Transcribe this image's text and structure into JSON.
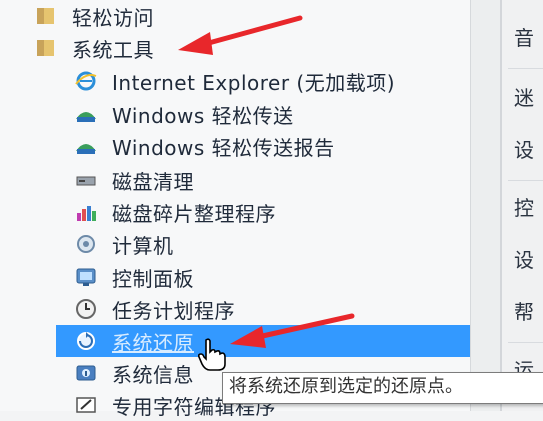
{
  "menu": {
    "items": [
      {
        "label": "轻松访问",
        "icon": "folder-icon"
      },
      {
        "label": "系统工具",
        "icon": "folder-icon"
      },
      {
        "label": "Internet Explorer (无加载项)",
        "icon": "internet-explorer-icon"
      },
      {
        "label": "Windows 轻松传送",
        "icon": "easy-transfer-icon"
      },
      {
        "label": "Windows 轻松传送报告",
        "icon": "easy-transfer-report-icon"
      },
      {
        "label": "磁盘清理",
        "icon": "disk-cleanup-icon"
      },
      {
        "label": "磁盘碎片整理程序",
        "icon": "defragmenter-icon"
      },
      {
        "label": "计算机",
        "icon": "computer-icon"
      },
      {
        "label": "控制面板",
        "icon": "control-panel-icon"
      },
      {
        "label": "任务计划程序",
        "icon": "task-scheduler-icon"
      },
      {
        "label": "系统还原",
        "icon": "system-restore-icon"
      },
      {
        "label": "系统信息",
        "icon": "system-info-icon"
      },
      {
        "label": "专用字符编辑程序",
        "icon": "char-editor-icon"
      }
    ],
    "selected_index": 10
  },
  "right_panel": {
    "items": [
      "音",
      "迷",
      "设",
      "控",
      "设",
      "帮",
      "运"
    ]
  },
  "tooltip": {
    "text": "将系统还原到选定的还原点。"
  },
  "colors": {
    "selection": "#3399ff",
    "annotation_arrow": "#e8272b"
  }
}
